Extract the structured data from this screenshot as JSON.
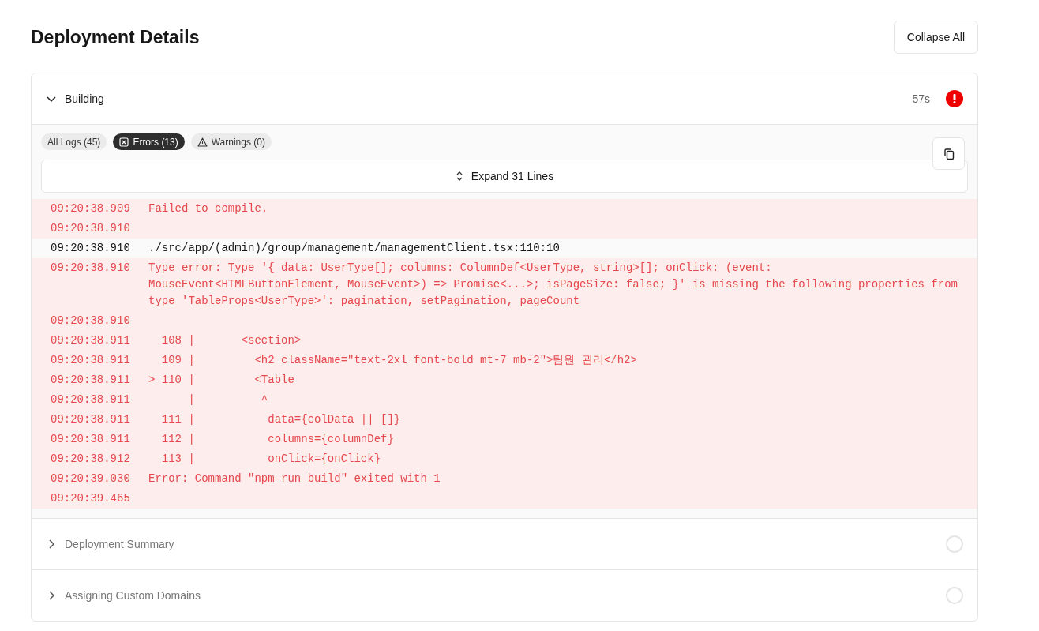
{
  "title": "Deployment Details",
  "collapse_button": "Collapse All",
  "sections": [
    {
      "title": "Building",
      "expanded": true,
      "kind": "error",
      "duration": "57s",
      "filters": [
        {
          "label": "All Logs (45)",
          "kind": "all",
          "selected": false
        },
        {
          "label": "Errors (13)",
          "kind": "error",
          "selected": true
        },
        {
          "label": "Warnings (0)",
          "kind": "warning",
          "selected": false
        }
      ],
      "expand_lines": "Expand 31 Lines",
      "logs": [
        {
          "time": "09:20:38.909",
          "message": "Failed to compile.",
          "kind": "error"
        },
        {
          "time": "09:20:38.910",
          "kind": "error"
        },
        {
          "time": "09:20:38.910",
          "message": "./src/app/(admin)/group/management/managementClient.tsx:110:10",
          "kind": "info"
        },
        {
          "time": "09:20:38.910",
          "message": "Type error: Type '{ data: UserType[]; columns: ColumnDef<UserType, string>[]; onClick: (event: MouseEvent<HTMLButtonElement, MouseEvent>) => Promise<...>; isPageSize: false; }' is missing the following properties from type 'TableProps<UserType>': pagination, setPagination, pageCount",
          "kind": "error"
        },
        {
          "time": "09:20:38.910",
          "kind": "error"
        },
        {
          "time": "09:20:38.911",
          "message": "  108 |       <section>",
          "kind": "error"
        },
        {
          "time": "09:20:38.911",
          "message": "  109 |         <h2 className=\"text-2xl font-bold mt-7 mb-2\">팀원 관리</h2>",
          "kind": "error"
        },
        {
          "time": "09:20:38.911",
          "message": "> 110 |         <Table",
          "kind": "error"
        },
        {
          "time": "09:20:38.911",
          "message": "      |          ^",
          "kind": "error"
        },
        {
          "time": "09:20:38.911",
          "message": "  111 |           data={colData || []}",
          "kind": "error"
        },
        {
          "time": "09:20:38.911",
          "message": "  112 |           columns={columnDef}",
          "kind": "error"
        },
        {
          "time": "09:20:38.912",
          "message": "  113 |           onClick={onClick}",
          "kind": "error"
        },
        {
          "time": "09:20:39.030",
          "message": "Error: Command \"npm run build\" exited with 1",
          "kind": "error"
        },
        {
          "time": "09:20:39.465",
          "kind": "error"
        }
      ]
    },
    {
      "title": "Deployment Summary",
      "expanded": false,
      "kind": "pending"
    },
    {
      "title": "Assigning Custom Domains",
      "expanded": false,
      "kind": "pending"
    }
  ]
}
